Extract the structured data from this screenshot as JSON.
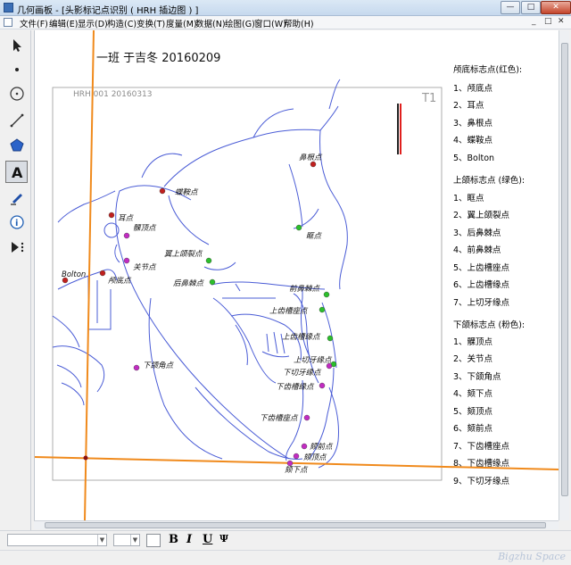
{
  "window": {
    "title": "几何画板 - [头影标记点识别 ( HRH 插边图 ) ]",
    "buttons": {
      "minimize": "—",
      "maximize": "□",
      "close": "✕"
    }
  },
  "menu": {
    "items": [
      "文件(F)",
      "编辑(E)",
      "显示(D)",
      "构造(C)",
      "变换(T)",
      "度量(M)",
      "数据(N)",
      "绘图(G)",
      "窗口(W)",
      "帮助(H)"
    ],
    "controls": [
      "_",
      "□",
      "✕"
    ]
  },
  "tools": [
    {
      "name": "arrow-select-tool",
      "icon": "arrow-icon"
    },
    {
      "name": "point-tool",
      "icon": "point-icon"
    },
    {
      "name": "compass-tool",
      "icon": "circle-icon"
    },
    {
      "name": "straightedge-tool",
      "icon": "line-icon"
    },
    {
      "name": "polygon-tool",
      "icon": "pentagon-icon"
    },
    {
      "name": "text-tool",
      "icon": "letter-a-icon"
    },
    {
      "name": "marker-tool",
      "icon": "pen-icon"
    },
    {
      "name": "information-tool",
      "icon": "info-icon"
    },
    {
      "name": "custom-tool",
      "icon": "play-more-icon"
    }
  ],
  "canvas": {
    "heading": "一班  于吉冬  20160209",
    "image_caption": "HRH 001   20160313",
    "image_tag": "T1",
    "landmarks": [
      {
        "label": "鼻根点",
        "group": "cranial",
        "color": "#c0201e"
      },
      {
        "label": "蝶鞍点",
        "group": "cranial",
        "color": "#c0201e"
      },
      {
        "label": "耳点",
        "group": "cranial",
        "color": "#c0201e"
      },
      {
        "label": "Bolton",
        "group": "cranial",
        "color": "#c0201e"
      },
      {
        "label": "颅底点",
        "group": "cranial",
        "color": "#c0201e"
      },
      {
        "label": "眶点",
        "group": "maxilla",
        "color": "#2bbf2b"
      },
      {
        "label": "翼上颌裂点",
        "group": "maxilla",
        "color": "#2bbf2b"
      },
      {
        "label": "后鼻棘点",
        "group": "maxilla",
        "color": "#2bbf2b"
      },
      {
        "label": "前鼻棘点",
        "group": "maxilla",
        "color": "#2bbf2b"
      },
      {
        "label": "上齿槽座点",
        "group": "maxilla",
        "color": "#2bbf2b"
      },
      {
        "label": "上齿槽缘点",
        "group": "maxilla",
        "color": "#2bbf2b"
      },
      {
        "label": "上切牙缘点",
        "group": "maxilla",
        "color": "#2bbf2b"
      },
      {
        "label": "髁顶点",
        "group": "mandible",
        "color": "#c22bc2"
      },
      {
        "label": "关节点",
        "group": "mandible",
        "color": "#c22bc2"
      },
      {
        "label": "下颌角点",
        "group": "mandible",
        "color": "#c22bc2"
      },
      {
        "label": "下切牙缘点",
        "group": "mandible",
        "color": "#c22bc2"
      },
      {
        "label": "下齿槽缘点",
        "group": "mandible",
        "color": "#c22bc2"
      },
      {
        "label": "下齿槽座点",
        "group": "mandible",
        "color": "#c22bc2"
      },
      {
        "label": "颏前点",
        "group": "mandible",
        "color": "#c22bc2"
      },
      {
        "label": "颏顶点",
        "group": "mandible",
        "color": "#c22bc2"
      },
      {
        "label": "颏下点",
        "group": "mandible",
        "color": "#c22bc2"
      }
    ],
    "axis_color": "#f08a1c"
  },
  "legend": {
    "cranial": {
      "title": "颅底标志点(红色):",
      "items": [
        "1、颅底点",
        "2、耳点",
        "3、鼻根点",
        "4、蝶鞍点",
        "5、Bolton"
      ]
    },
    "maxilla": {
      "title": "上颌标志点 (绿色):",
      "items": [
        "1、眶点",
        "2、翼上颌裂点",
        "3、后鼻棘点",
        "4、前鼻棘点",
        "5、上齿槽座点",
        "6、上齿槽缘点",
        "7、上切牙缘点"
      ]
    },
    "mandible": {
      "title": "下颌标志点 (粉色):",
      "items": [
        "1、髁顶点",
        "2、关节点",
        "3、下颌角点",
        "4、颏下点",
        "5、颏顶点",
        "6、颏前点",
        "7、下齿槽座点",
        "8、下齿槽缘点",
        "9、下切牙缘点"
      ]
    }
  },
  "textbar": {
    "bold": "B",
    "italic": "I",
    "underline": "U",
    "symbol": "Ψ"
  },
  "status": {
    "watermark": "Bigzhu Space"
  }
}
